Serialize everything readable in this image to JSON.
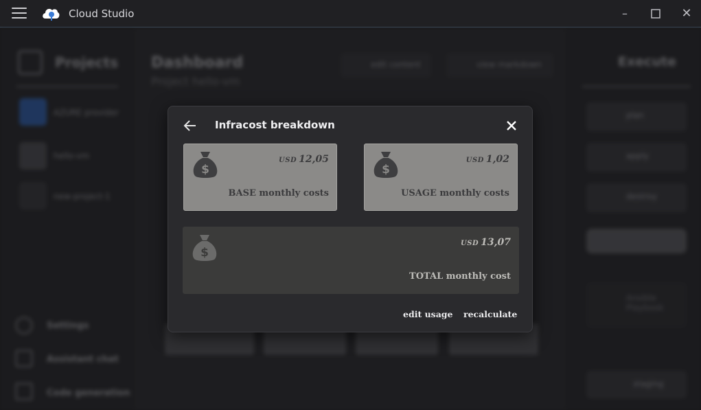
{
  "titlebar": {
    "app_title": "Cloud Studio",
    "menu_icon": "hamburger-icon",
    "logo_icon": "cloud-logo-icon"
  },
  "background": {
    "left": {
      "heading": "Projects",
      "items": [
        "AZURE provider",
        "hello-vm",
        "new-project-1"
      ],
      "bottom": [
        "Settings",
        "Assistant chat",
        "Code generation"
      ]
    },
    "center": {
      "title": "Dashboard",
      "subtitle": "Project hello-vm",
      "buttons": [
        "edit content",
        "view markdown"
      ]
    },
    "right": {
      "heading": "Execute",
      "buttons": [
        "plan",
        "apply",
        "destroy"
      ],
      "ansible": "Ansible Playbook",
      "environment": "staging"
    }
  },
  "modal": {
    "title": "Infracost breakdown",
    "back_icon": "arrow-left-icon",
    "close_icon": "close-icon",
    "base": {
      "currency": "USD",
      "amount": "12,05",
      "label": "BASE monthly costs"
    },
    "usage": {
      "currency": "USD",
      "amount": "1,02",
      "label": "USAGE monthly costs"
    },
    "total": {
      "currency": "USD",
      "amount": "13,07",
      "label": "TOTAL monthly cost"
    },
    "edit_usage": "edit usage",
    "recalculate": "recalculate"
  },
  "colors": {
    "card_bg": "#8b8a88",
    "total_card_bg": "#3b3b3a",
    "modal_bg": "#2a2a2d",
    "accent_border": "#3b4a5a"
  }
}
